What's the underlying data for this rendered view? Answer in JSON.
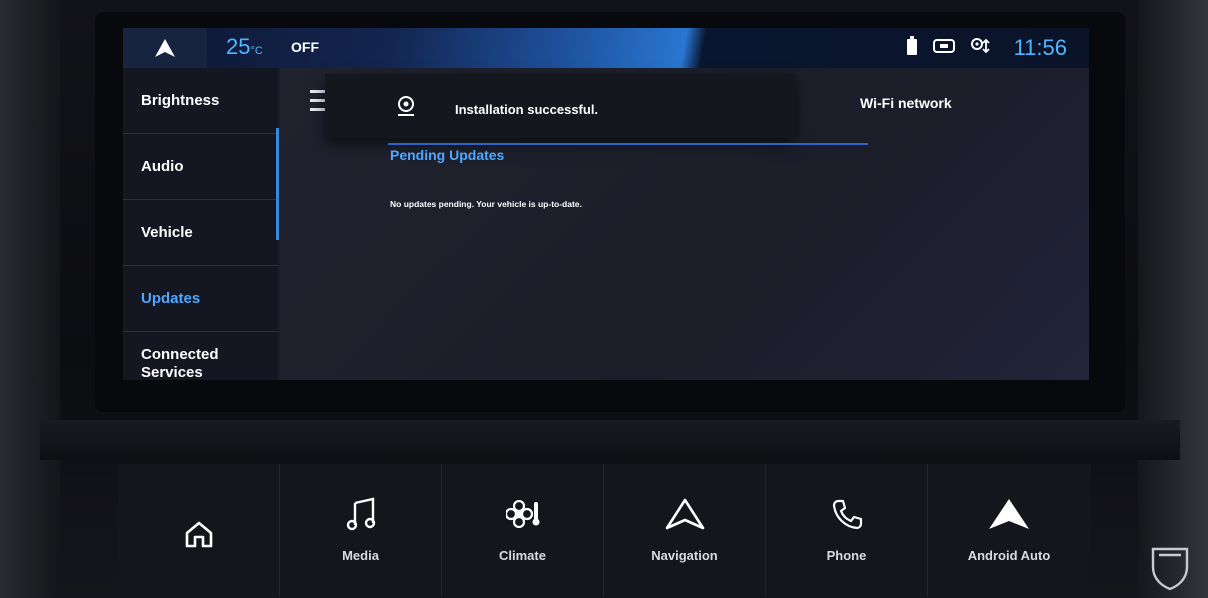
{
  "status_bar": {
    "temperature": "25",
    "temperature_unit": "°C",
    "fan_status": "OFF",
    "time": "11:56"
  },
  "side_menu": {
    "items": [
      {
        "label": "Brightness"
      },
      {
        "label": "Audio"
      },
      {
        "label": "Vehicle"
      },
      {
        "label": "Updates",
        "active": true
      },
      {
        "label": "Connected Services"
      }
    ]
  },
  "toast": {
    "message": "Installation successful."
  },
  "main": {
    "wifi_label": "Wi-Fi network",
    "section_title": "Pending Updates",
    "empty_message": "No updates pending. Your vehicle is up-to-date."
  },
  "dock": {
    "items": [
      {
        "label": "",
        "icon": "home-icon"
      },
      {
        "label": "Media",
        "icon": "music-icon"
      },
      {
        "label": "Climate",
        "icon": "climate-icon"
      },
      {
        "label": "Navigation",
        "icon": "navigation-icon"
      },
      {
        "label": "Phone",
        "icon": "phone-icon"
      },
      {
        "label": "Android Auto",
        "icon": "android-auto-icon"
      }
    ]
  },
  "colors": {
    "accent": "#4fa8ff",
    "screen_bg": "#1b1d2a"
  }
}
